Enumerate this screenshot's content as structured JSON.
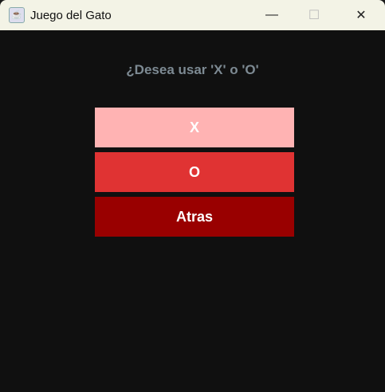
{
  "window": {
    "title": "Juego del Gato"
  },
  "prompt": "¿Desea usar 'X' o 'O'",
  "buttons": {
    "x": "X",
    "o": "O",
    "back": "Atras"
  },
  "colors": {
    "x": "#ffb3b3",
    "o": "#e03333",
    "back": "#990000"
  }
}
